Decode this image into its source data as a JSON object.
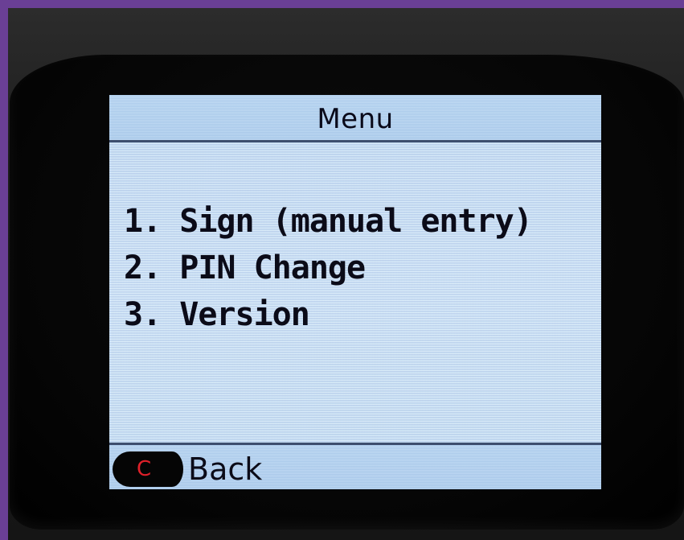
{
  "screen": {
    "title": "Menu",
    "menu_items": [
      {
        "label": "1. Sign (manual entry)"
      },
      {
        "label": "2. PIN Change"
      },
      {
        "label": "3. Version"
      }
    ]
  },
  "softkeys": {
    "back_label": "Back",
    "back_key_glyph": "C",
    "back_key_icon": "red-c-key-icon"
  },
  "colors": {
    "frame": "#6a3f95",
    "screen_background": "#c4e0f6",
    "text": "#0b0b18",
    "key_glyph": "#e0202a"
  }
}
